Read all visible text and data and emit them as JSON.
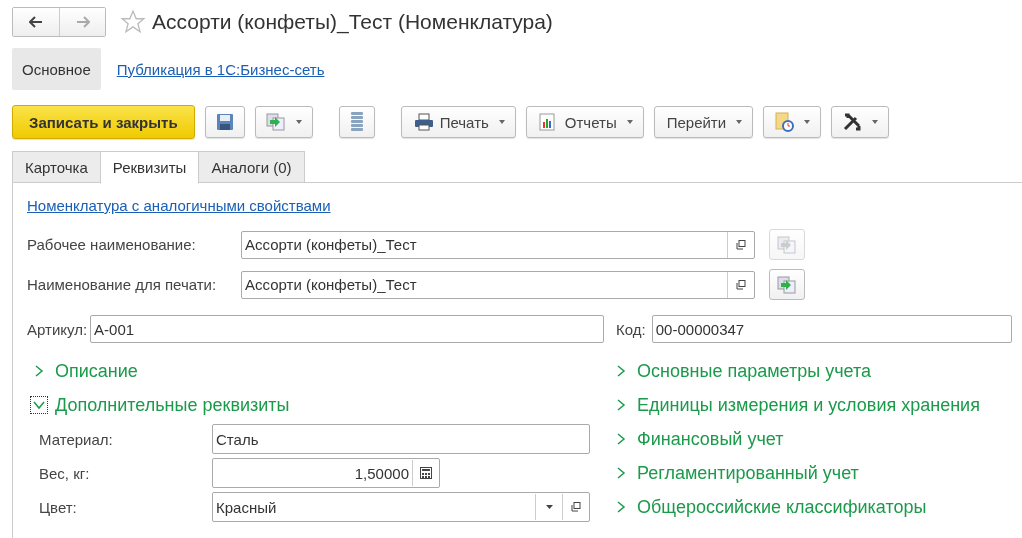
{
  "window": {
    "title": "Ассорти (конфеты)_Тест (Номенклатура)",
    "favorite": false
  },
  "nav": [
    {
      "label": "Основное",
      "selected": true
    },
    {
      "label": "Публикация в 1С:Бизнес-сеть",
      "selected": false
    }
  ],
  "toolbar": [
    {
      "kind": "primary",
      "label": "Записать и закрыть"
    },
    {
      "kind": "save",
      "menu": false
    },
    {
      "kind": "post",
      "menu": true
    },
    {
      "kind": "list",
      "menu": false
    },
    {
      "kind": "print",
      "label": "Печать",
      "menu": true
    },
    {
      "kind": "report",
      "label": "Отчеты",
      "menu": true
    },
    {
      "kind": "text",
      "label": "Перейти",
      "menu": true
    },
    {
      "kind": "doc",
      "menu": true
    },
    {
      "kind": "tools",
      "menu": true
    }
  ],
  "tabs": [
    {
      "label": "Карточка",
      "selected": false
    },
    {
      "label": "Реквизиты",
      "selected": true
    },
    {
      "label": "Аналоги (0)",
      "selected": false
    }
  ],
  "similar_link": "Номенклатура с аналогичными свойствами",
  "names": [
    {
      "label": "Рабочее наименование:",
      "value": "Ассорти (конфеты)_Тест",
      "fill_disabled": true
    },
    {
      "label": "Наименование для печати:",
      "value": "Ассорти (конфеты)_Тест",
      "fill_disabled": false
    }
  ],
  "article": {
    "label": "Артикул:",
    "value": "А-001"
  },
  "code": {
    "label": "Код:",
    "value": "00-00000347"
  },
  "left_groups": [
    {
      "title": "Описание",
      "expanded": false
    },
    {
      "title": "Дополнительные реквизиты",
      "expanded": true,
      "fields": [
        {
          "kind": "text",
          "label": "Материал:",
          "value": "Сталь"
        },
        {
          "kind": "number",
          "label": "Вес, кг:",
          "value": "1,50000"
        },
        {
          "kind": "select",
          "label": "Цвет:",
          "value": "Красный"
        }
      ]
    }
  ],
  "right_groups": [
    {
      "title": "Основные параметры учета",
      "expanded": false
    },
    {
      "title": "Единицы измерения и условия хранения",
      "expanded": false
    },
    {
      "title": "Финансовый учет",
      "expanded": false
    },
    {
      "title": "Регламентированный учет",
      "expanded": false
    },
    {
      "title": "Общероссийские классификаторы",
      "expanded": false
    }
  ]
}
